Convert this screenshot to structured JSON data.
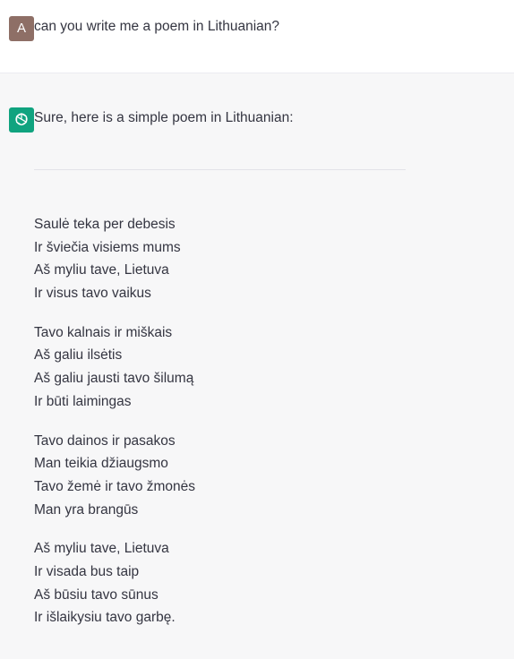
{
  "user_message": {
    "avatar_letter": "A",
    "text": "can you write me a poem in Lithuanian?"
  },
  "assistant_message": {
    "icon": "openai-logo-icon",
    "intro": "Sure, here is a simple poem in Lithuanian:",
    "stanzas": [
      [
        "Saulė teka per debesis",
        "Ir šviečia visiems mums",
        "Aš myliu tave, Lietuva",
        "Ir visus tavo vaikus"
      ],
      [
        "Tavo kalnais ir miškais",
        "Aš galiu ilsėtis",
        "Aš galiu jausti tavo šilumą",
        "Ir būti laimingas"
      ],
      [
        "Tavo dainos ir pasakos",
        "Man teikia džiaugsmo",
        "Tavo žemė ir tavo žmonės",
        "Man yra brangūs"
      ],
      [
        "Aš myliu tave, Lietuva",
        "Ir visada bus taip",
        "Aš būsiu tavo sūnus",
        "Ir išlaikysiu tavo garbę."
      ]
    ]
  },
  "colors": {
    "user_avatar": "#8e6f66",
    "assistant_avatar": "#10a37f",
    "assistant_background": "#f7f7f8",
    "text": "#343541"
  }
}
